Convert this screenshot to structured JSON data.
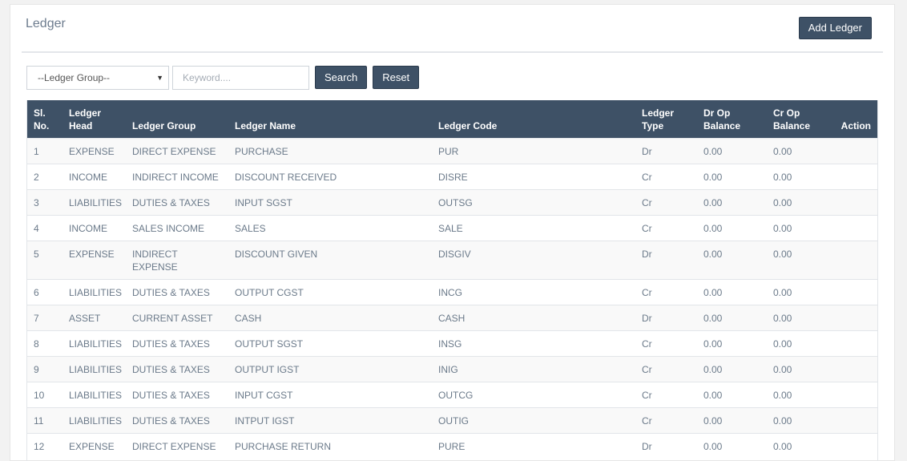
{
  "header": {
    "title": "Ledger",
    "add_button": "Add Ledger"
  },
  "filters": {
    "group_select_value": "--Ledger Group--",
    "keyword_placeholder": "Keyword....",
    "search_label": "Search",
    "reset_label": "Reset"
  },
  "table": {
    "columns": {
      "sl_no": [
        "Sl.",
        "No."
      ],
      "ledger_head": [
        "Ledger",
        "Head"
      ],
      "ledger_group": "Ledger Group",
      "ledger_name": "Ledger Name",
      "ledger_code": "Ledger Code",
      "ledger_type": [
        "Ledger",
        "Type"
      ],
      "dr_op_balance": [
        "Dr Op",
        "Balance"
      ],
      "cr_op_balance": [
        "Cr Op",
        "Balance"
      ],
      "action": "Action"
    },
    "rows": [
      {
        "sl": "1",
        "head": "EXPENSE",
        "group": "DIRECT EXPENSE",
        "name": "PURCHASE",
        "code": "PUR",
        "type": "Dr",
        "dr": "0.00",
        "cr": "0.00"
      },
      {
        "sl": "2",
        "head": "INCOME",
        "group": "INDIRECT INCOME",
        "name": "DISCOUNT RECEIVED",
        "code": "DISRE",
        "type": "Cr",
        "dr": "0.00",
        "cr": "0.00"
      },
      {
        "sl": "3",
        "head": "LIABILITIES",
        "group": "DUTIES & TAXES",
        "name": "INPUT SGST",
        "code": "OUTSG",
        "type": "Cr",
        "dr": "0.00",
        "cr": "0.00"
      },
      {
        "sl": "4",
        "head": "INCOME",
        "group": "SALES INCOME",
        "name": "SALES",
        "code": "SALE",
        "type": "Cr",
        "dr": "0.00",
        "cr": "0.00"
      },
      {
        "sl": "5",
        "head": "EXPENSE",
        "group": "INDIRECT EXPENSE",
        "name": "DISCOUNT GIVEN",
        "code": "DISGIV",
        "type": "Dr",
        "dr": "0.00",
        "cr": "0.00"
      },
      {
        "sl": "6",
        "head": "LIABILITIES",
        "group": "DUTIES & TAXES",
        "name": "OUTPUT CGST",
        "code": "INCG",
        "type": "Cr",
        "dr": "0.00",
        "cr": "0.00"
      },
      {
        "sl": "7",
        "head": "ASSET",
        "group": "CURRENT ASSET",
        "name": "CASH",
        "code": "CASH",
        "type": "Dr",
        "dr": "0.00",
        "cr": "0.00"
      },
      {
        "sl": "8",
        "head": "LIABILITIES",
        "group": "DUTIES & TAXES",
        "name": "OUTPUT SGST",
        "code": "INSG",
        "type": "Cr",
        "dr": "0.00",
        "cr": "0.00"
      },
      {
        "sl": "9",
        "head": "LIABILITIES",
        "group": "DUTIES & TAXES",
        "name": "OUTPUT IGST",
        "code": "INIG",
        "type": "Cr",
        "dr": "0.00",
        "cr": "0.00"
      },
      {
        "sl": "10",
        "head": "LIABILITIES",
        "group": "DUTIES & TAXES",
        "name": "INPUT CGST",
        "code": "OUTCG",
        "type": "Cr",
        "dr": "0.00",
        "cr": "0.00"
      },
      {
        "sl": "11",
        "head": "LIABILITIES",
        "group": "DUTIES & TAXES",
        "name": "INTPUT IGST",
        "code": "OUTIG",
        "type": "Cr",
        "dr": "0.00",
        "cr": "0.00"
      },
      {
        "sl": "12",
        "head": "EXPENSE",
        "group": "DIRECT EXPENSE",
        "name": "PURCHASE RETURN",
        "code": "PURE",
        "type": "Dr",
        "dr": "0.00",
        "cr": "0.00"
      }
    ]
  }
}
